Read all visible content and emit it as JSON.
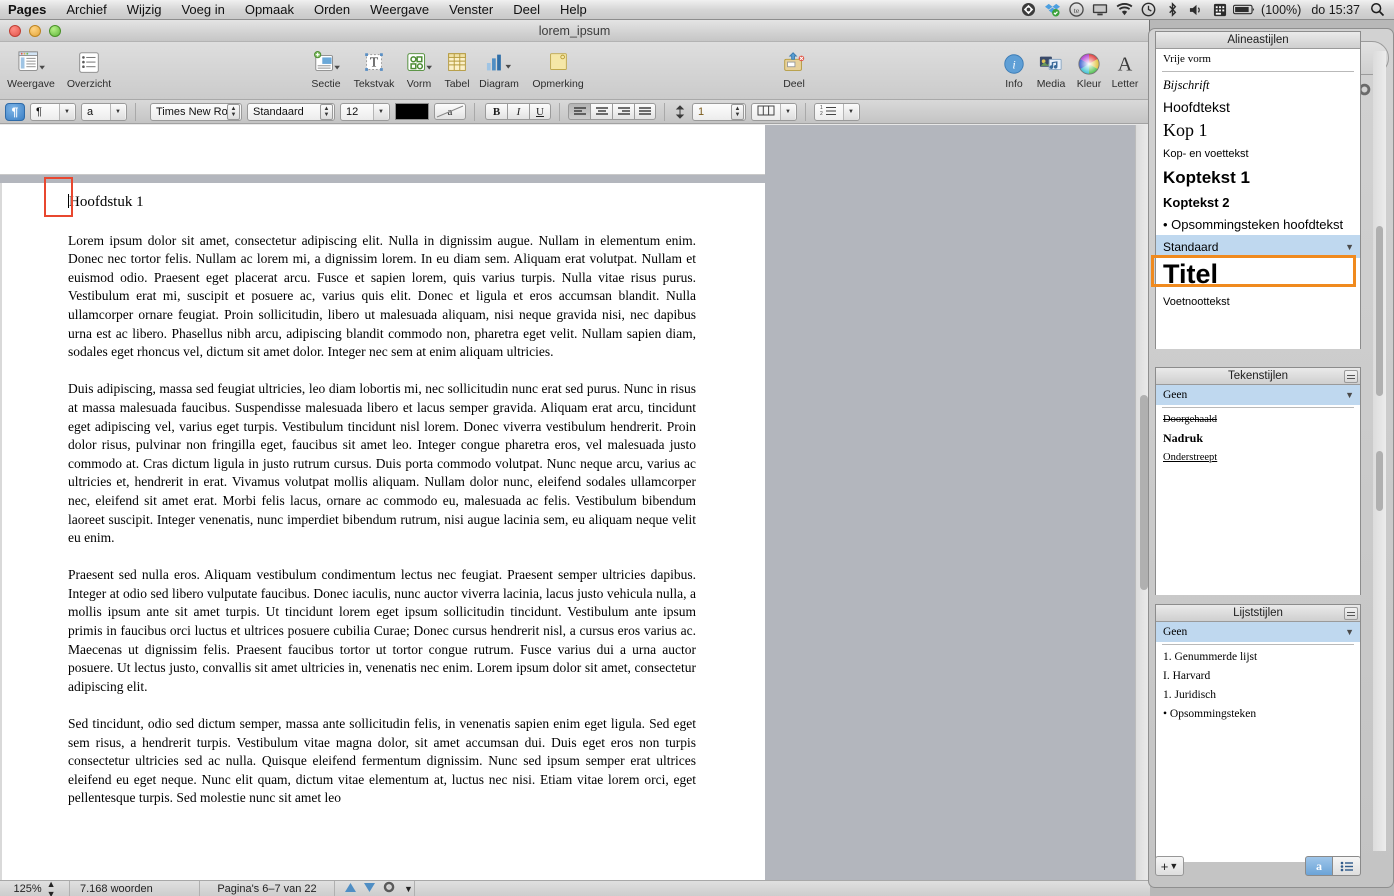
{
  "menubar": {
    "app": "Pages",
    "items": [
      "Archief",
      "Wijzig",
      "Voeg in",
      "Opmaak",
      "Orden",
      "Weergave",
      "Venster",
      "Deel",
      "Help"
    ],
    "status_icons": [
      "cloud-sync-icon",
      "dropbox-icon",
      "te-icon",
      "display-icon",
      "wifi-icon",
      "time-machine-icon",
      "bluetooth-icon",
      "volume-icon",
      "input-source-icon",
      "battery-icon"
    ],
    "battery_pct": "(100%)",
    "clock": "do 15:37",
    "search_icon": "search-icon"
  },
  "window": {
    "title": "lorem_ipsum"
  },
  "toolbar": {
    "items": [
      {
        "label": "Weergave",
        "icon": "view-icon",
        "menu": true
      },
      {
        "label": "Overzicht",
        "icon": "outline-icon",
        "menu": false
      },
      {
        "label": "Sectie",
        "icon": "section-icon",
        "menu": true
      },
      {
        "label": "Tekstvak",
        "icon": "textbox-icon",
        "menu": false
      },
      {
        "label": "Vorm",
        "icon": "shape-icon",
        "menu": true
      },
      {
        "label": "Tabel",
        "icon": "table-icon",
        "menu": false
      },
      {
        "label": "Diagram",
        "icon": "chart-icon",
        "menu": true
      },
      {
        "label": "Opmerking",
        "icon": "comment-icon",
        "menu": false
      },
      {
        "label": "Deel",
        "icon": "share-icon",
        "menu": false
      },
      {
        "label": "Info",
        "icon": "info-icon",
        "menu": false
      },
      {
        "label": "Media",
        "icon": "media-icon",
        "menu": false
      },
      {
        "label": "Kleur",
        "icon": "color-wheel-icon",
        "menu": false
      },
      {
        "label": "Letter",
        "icon": "fonts-icon",
        "menu": false
      }
    ]
  },
  "formatbar": {
    "pilcrow_toggle": "¶",
    "paragraph_menu": "¶",
    "character_menu": "a",
    "font_family": "Times New Ro...",
    "font_style": "Standaard",
    "font_size": "12",
    "text_color": "#000000",
    "background_swatch_label": "a",
    "bold": "B",
    "italic": "I",
    "underline": "U",
    "align_active": "left",
    "line_spacing": "1",
    "columns_icon": "columns-icon",
    "list_icon": "list-icon"
  },
  "document": {
    "heading": "Hoofdstuk 1",
    "paragraphs": [
      "Lorem ipsum dolor sit amet, consectetur adipiscing elit. Nulla in dignissim augue. Nullam in elementum enim. Donec nec tortor felis. Nullam ac lorem mi, a dignissim lorem. In eu diam sem. Aliquam erat volutpat. Nullam et euismod odio. Praesent eget placerat arcu. Fusce et sapien lorem, quis varius turpis. Nulla vitae risus purus. Vestibulum erat mi, suscipit et posuere ac, varius quis elit. Donec et ligula et eros accumsan blandit. Nulla ullamcorper ornare feugiat. Proin sollicitudin, libero ut malesuada aliquam, nisi neque gravida nisi, nec dapibus urna est ac libero. Phasellus nibh arcu, adipiscing blandit commodo non, pharetra eget velit. Nullam sapien diam, sodales eget rhoncus vel, dictum sit amet dolor. Integer nec sem at enim aliquam ultricies.",
      "Duis adipiscing, massa sed feugiat ultricies, leo diam lobortis mi, nec sollicitudin nunc erat sed purus. Nunc in risus at massa malesuada faucibus. Suspendisse malesuada libero et lacus semper gravida. Aliquam erat arcu, tincidunt eget adipiscing vel, varius eget turpis. Vestibulum tincidunt nisl lorem. Donec viverra vestibulum hendrerit. Proin dolor risus, pulvinar non fringilla eget, faucibus sit amet leo. Integer congue pharetra eros, vel malesuada justo commodo at. Cras dictum ligula in justo rutrum cursus. Duis porta commodo volutpat. Nunc neque arcu, varius ac ultricies et, hendrerit in erat. Vivamus volutpat mollis aliquam. Nullam dolor nunc, eleifend sodales ullamcorper nec, eleifend sit amet erat. Morbi felis lacus, ornare ac commodo eu, malesuada ac felis. Vestibulum bibendum laoreet suscipit. Integer venenatis, nunc imperdiet bibendum rutrum, nisi augue lacinia sem, eu aliquam neque velit eu enim.",
      "Praesent sed nulla eros. Aliquam vestibulum condimentum lectus nec feugiat. Praesent semper ultricies dapibus. Integer at odio sed libero vulputate faucibus. Donec iaculis, nunc auctor viverra lacinia, lacus justo vehicula nulla, a mollis ipsum ante sit amet turpis. Ut tincidunt lorem eget ipsum sollicitudin tincidunt. Vestibulum ante ipsum primis in faucibus orci luctus et ultrices posuere cubilia Curae; Donec cursus hendrerit nisl, a cursus eros varius ac. Maecenas ut dignissim felis. Praesent faucibus tortor ut tortor congue rutrum. Fusce varius dui a urna auctor posuere. Ut lectus justo, convallis sit amet ultricies in, venenatis nec enim. Lorem ipsum dolor sit amet, consectetur adipiscing elit.",
      "Sed tincidunt, odio sed dictum semper, massa ante sollicitudin felis, in venenatis sapien enim eget ligula. Sed eget sem risus, a hendrerit turpis. Vestibulum vitae magna dolor, sit amet accumsan dui. Duis eget eros non turpis consectetur ultricies sed ac nulla. Quisque eleifend fermentum dignissim. Nunc sed ipsum semper erat ultrices eleifend eu eget neque. Nunc elit quam, dictum vitae elementum at, luctus nec nisi. Etiam vitae lorem orci, eget pellentesque turpis. Sed molestie nunc sit amet leo"
    ]
  },
  "statusbar": {
    "zoom": "125%",
    "word_count": "7.168 woorden",
    "pages": "Pagina's 6–7 van 22",
    "prev_icon": "page-up-icon",
    "next_icon": "page-down-icon",
    "gear_icon": "gear-icon"
  },
  "drawer": {
    "paragraph_styles": {
      "title": "Alineastijlen",
      "free_form": "Vrije vorm",
      "items": [
        {
          "label": "Bijschrift",
          "preview": "caption"
        },
        {
          "label": "Hoofdtekst",
          "preview": "body"
        },
        {
          "label": "Kop 1",
          "preview": "heading1"
        },
        {
          "label": "Kop- en voettekst",
          "preview": "headerfooter"
        },
        {
          "label": "Koptekst 1",
          "preview": "koptekst1"
        },
        {
          "label": "Koptekst 2",
          "preview": "koptekst2"
        },
        {
          "label": "• Opsommingsteken hoofdtekst",
          "preview": "bulletbody"
        },
        {
          "label": "Standaard",
          "preview": "standaard",
          "selected": true,
          "has_menu": true
        },
        {
          "label": "Titel",
          "preview": "titel"
        },
        {
          "label": "Voetnoottekst",
          "preview": "footnote"
        }
      ]
    },
    "character_styles": {
      "title": "Tekenstijlen",
      "items": [
        {
          "label": "Geen",
          "preview": "none",
          "selected": true,
          "has_menu": true
        },
        {
          "label": "Doorgehaald",
          "preview": "strike"
        },
        {
          "label": "Nadruk",
          "preview": "bold"
        },
        {
          "label": "Onderstreept",
          "preview": "underline"
        }
      ]
    },
    "list_styles": {
      "title": "Lijststijlen",
      "items": [
        {
          "label": "Geen",
          "preview": "none",
          "selected": true,
          "has_menu": true
        },
        {
          "label": "1.  Genummerde lijst",
          "preview": "numbered"
        },
        {
          "label": "I.  Harvard",
          "preview": "harvard"
        },
        {
          "label": "1.  Juridisch",
          "preview": "legal"
        },
        {
          "label": "•  Opsommingsteken",
          "preview": "bullet"
        }
      ]
    },
    "add_button": "+",
    "toggle_char_styles": "a",
    "toggle_list_styles": "list-icon"
  },
  "annotations": {
    "cursor_box_color": "#e8472f",
    "style_box_color": "#f08a1e"
  }
}
